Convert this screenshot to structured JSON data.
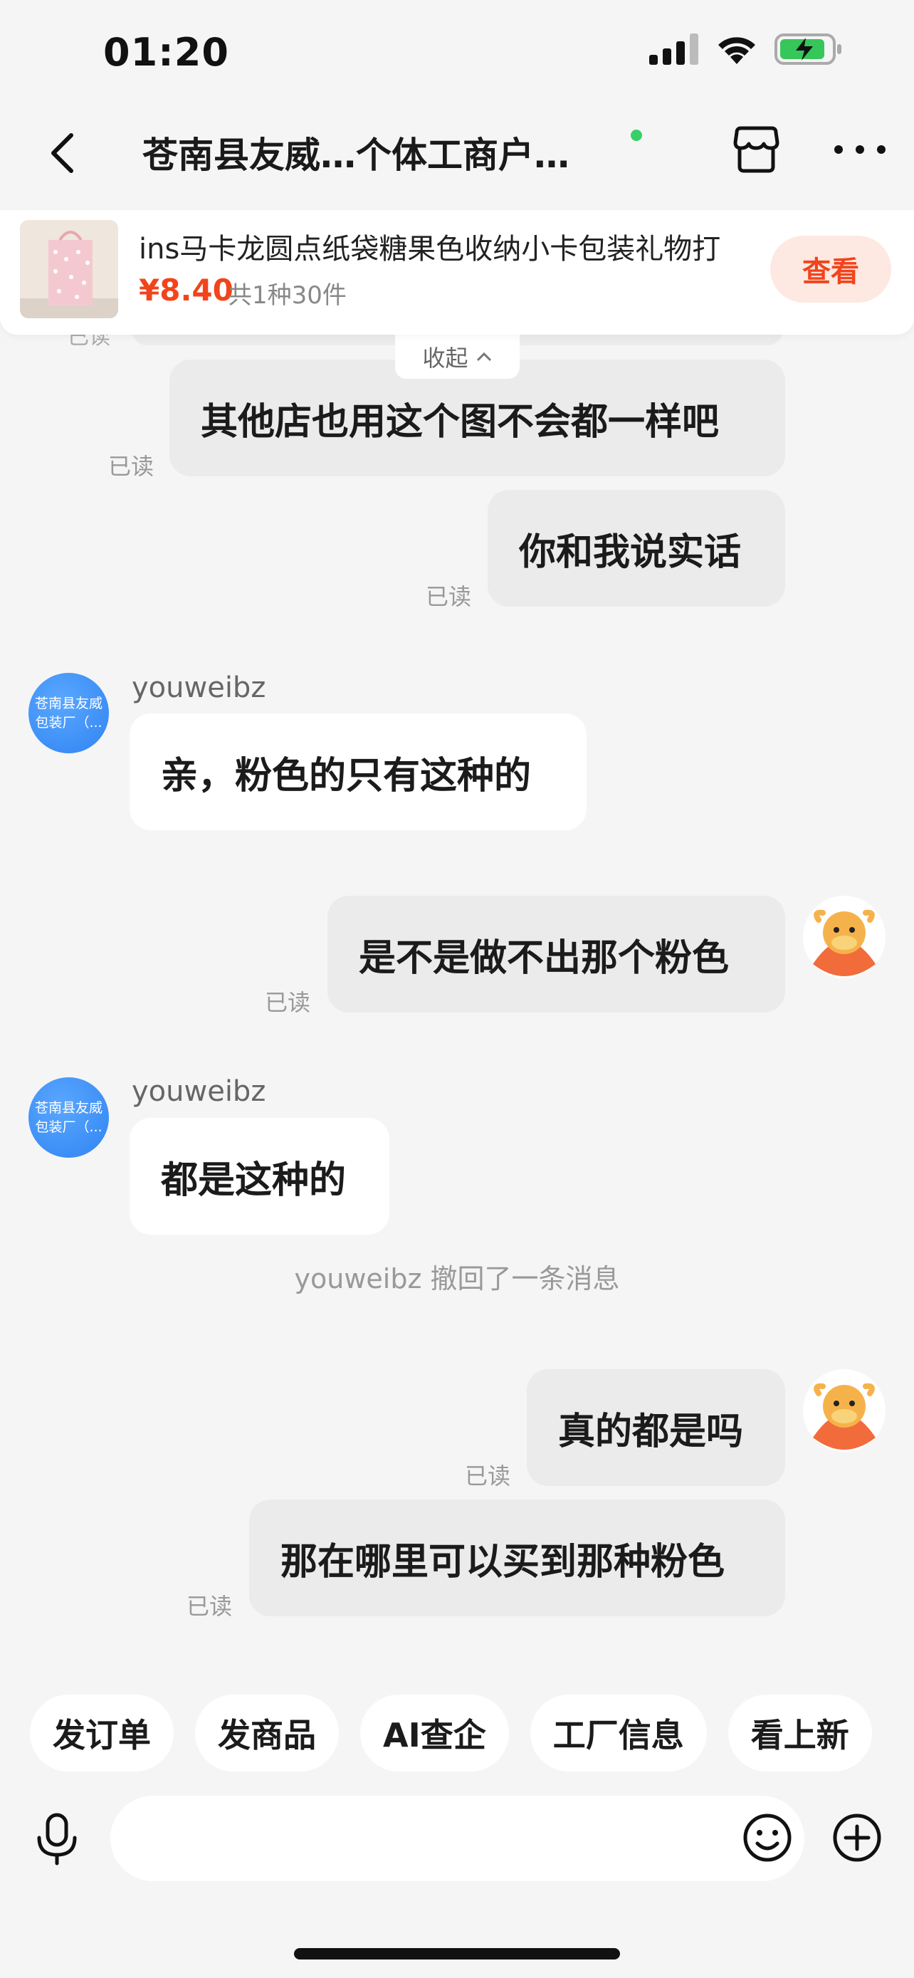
{
  "status_bar": {
    "time": "01:20"
  },
  "header": {
    "title": "苍南县友威…个体工商户…",
    "online": true
  },
  "product": {
    "title": "ins马卡龙圆点纸袋糖果色收纳小卡包装礼物打",
    "price": "¥8.40",
    "quantity": "共1种30件",
    "view_label": "查看"
  },
  "collapse_label": "收起",
  "read_label": "已读",
  "shop_avatar_text": [
    "苍南县友威",
    "包装厂（..."
  ],
  "messages": [
    {
      "side": "out",
      "text": "其他店也用这个图不会都一样吧"
    },
    {
      "side": "out",
      "text": "你和我说实话"
    },
    {
      "side": "in",
      "sender": "youweibz",
      "text": "亲，粉色的只有这种的"
    },
    {
      "side": "out",
      "text": "是不是做不出那个粉色"
    },
    {
      "side": "in",
      "sender": "youweibz",
      "text": "都是这种的"
    },
    {
      "side": "system",
      "text": "youweibz 撤回了一条消息"
    },
    {
      "side": "out",
      "text": "真的都是吗"
    },
    {
      "side": "out",
      "text": "那在哪里可以买到那种粉色"
    }
  ],
  "quick_actions": [
    "发订单",
    "发商品",
    "AI查企",
    "工厂信息",
    "看上新"
  ],
  "input": {
    "placeholder": ""
  },
  "colors": {
    "accent": "#f2441c",
    "online_dot": "#35d06a",
    "shop_avatar": "#3a8cf5",
    "background": "#f5f5f5"
  }
}
